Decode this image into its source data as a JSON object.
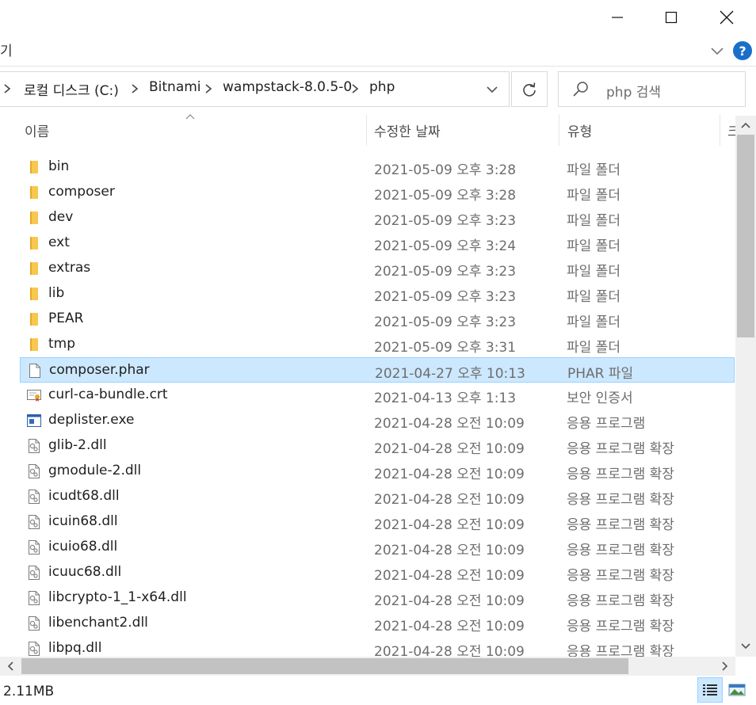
{
  "window": {
    "controls": {
      "minimize": "minimize",
      "maximize": "maximize",
      "close": "close"
    }
  },
  "ribbon": {
    "left_text": "기",
    "help_label": "?"
  },
  "address": {
    "breadcrumbs": [
      "로컬 디스크 (C:)",
      "Bitnami",
      "wampstack-8.0.5-0",
      "php"
    ]
  },
  "search": {
    "placeholder": "php 검색"
  },
  "columns": {
    "name": "이름",
    "date": "수정한 날짜",
    "type": "유형",
    "size": "크"
  },
  "files": [
    {
      "name": "bin",
      "date": "2021-05-09 오후 3:28",
      "type": "파일 폴더",
      "icon": "folder-icon"
    },
    {
      "name": "composer",
      "date": "2021-05-09 오후 3:28",
      "type": "파일 폴더",
      "icon": "folder-icon"
    },
    {
      "name": "dev",
      "date": "2021-05-09 오후 3:23",
      "type": "파일 폴더",
      "icon": "folder-icon"
    },
    {
      "name": "ext",
      "date": "2021-05-09 오후 3:24",
      "type": "파일 폴더",
      "icon": "folder-icon"
    },
    {
      "name": "extras",
      "date": "2021-05-09 오후 3:23",
      "type": "파일 폴더",
      "icon": "folder-icon"
    },
    {
      "name": "lib",
      "date": "2021-05-09 오후 3:23",
      "type": "파일 폴더",
      "icon": "folder-icon"
    },
    {
      "name": "PEAR",
      "date": "2021-05-09 오후 3:23",
      "type": "파일 폴더",
      "icon": "folder-icon"
    },
    {
      "name": "tmp",
      "date": "2021-05-09 오후 3:31",
      "type": "파일 폴더",
      "icon": "folder-icon"
    },
    {
      "name": "composer.phar",
      "date": "2021-04-27 오후 10:13",
      "type": "PHAR 파일",
      "icon": "file-icon",
      "selected": true
    },
    {
      "name": "curl-ca-bundle.crt",
      "date": "2021-04-13 오후 1:13",
      "type": "보안 인증서",
      "icon": "certificate-icon"
    },
    {
      "name": "deplister.exe",
      "date": "2021-04-28 오전 10:09",
      "type": "응용 프로그램",
      "icon": "application-icon"
    },
    {
      "name": "glib-2.dll",
      "date": "2021-04-28 오전 10:09",
      "type": "응용 프로그램 확장",
      "icon": "dll-icon"
    },
    {
      "name": "gmodule-2.dll",
      "date": "2021-04-28 오전 10:09",
      "type": "응용 프로그램 확장",
      "icon": "dll-icon"
    },
    {
      "name": "icudt68.dll",
      "date": "2021-04-28 오전 10:09",
      "type": "응용 프로그램 확장",
      "icon": "dll-icon"
    },
    {
      "name": "icuin68.dll",
      "date": "2021-04-28 오전 10:09",
      "type": "응용 프로그램 확장",
      "icon": "dll-icon"
    },
    {
      "name": "icuio68.dll",
      "date": "2021-04-28 오전 10:09",
      "type": "응용 프로그램 확장",
      "icon": "dll-icon"
    },
    {
      "name": "icuuc68.dll",
      "date": "2021-04-28 오전 10:09",
      "type": "응용 프로그램 확장",
      "icon": "dll-icon"
    },
    {
      "name": "libcrypto-1_1-x64.dll",
      "date": "2021-04-28 오전 10:09",
      "type": "응용 프로그램 확장",
      "icon": "dll-icon"
    },
    {
      "name": "libenchant2.dll",
      "date": "2021-04-28 오전 10:09",
      "type": "응용 프로그램 확장",
      "icon": "dll-icon"
    },
    {
      "name": "libpq.dll",
      "date": "2021-04-28 오전 10:09",
      "type": "응용 프로그램 확장",
      "icon": "dll-icon"
    }
  ],
  "status": {
    "selection_size": "2.11MB"
  },
  "colors": {
    "selection_bg": "#cce8ff",
    "selection_border": "#99d1ff",
    "folder": "#f8c74e",
    "help_blue": "#1a6fc9"
  }
}
